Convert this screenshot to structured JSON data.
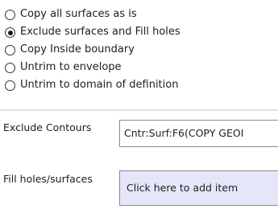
{
  "options": [
    {
      "label": "Copy all surfaces as is",
      "selected": false
    },
    {
      "label": "Exclude surfaces and Fill holes",
      "selected": true
    },
    {
      "label": "Copy Inside boundary",
      "selected": false
    },
    {
      "label": "Untrim to envelope",
      "selected": false
    },
    {
      "label": "Untrim to domain of definition",
      "selected": false
    }
  ],
  "exclude_contours": {
    "label": "Exclude Contours",
    "value": "Cntr:Surf:F6(COPY GEOI"
  },
  "fill_holes": {
    "label": "Fill holes/surfaces",
    "value": "Click here to add item"
  }
}
